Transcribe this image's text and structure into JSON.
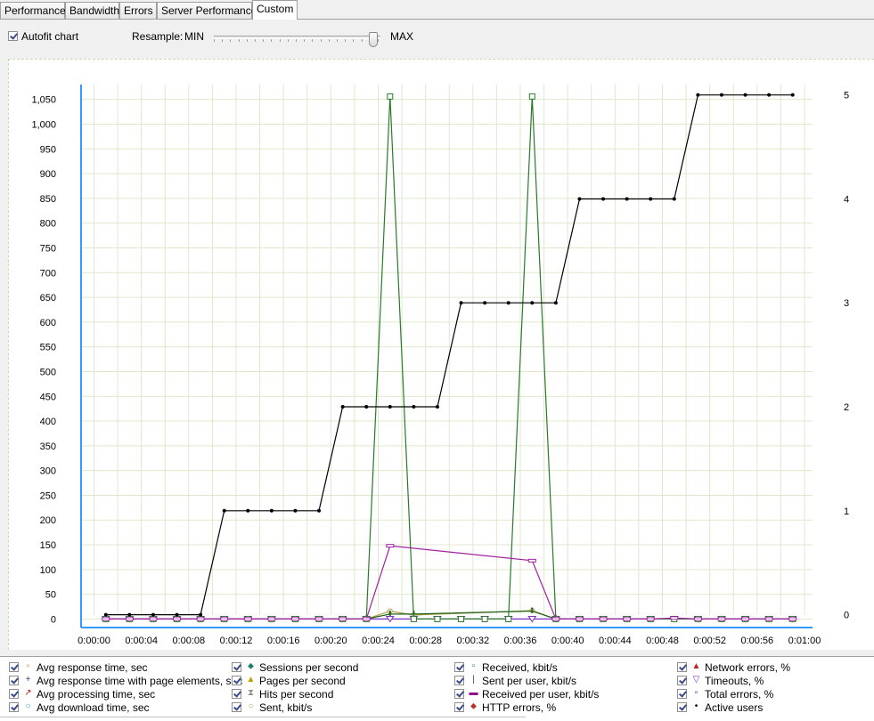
{
  "tabs": [
    "Performance",
    "Bandwidth",
    "Errors",
    "Server Performance",
    "Custom"
  ],
  "active_tab": "Custom",
  "controls": {
    "autofit_label": "Autofit chart",
    "autofit_checked": true,
    "resample_label": "Resample:",
    "resample_min": "MIN",
    "resample_max": "MAX",
    "resample_level": 1.0
  },
  "legend": {
    "columns": [
      [
        {
          "label": "Avg response time, sec",
          "icon": "square-marker",
          "color": "#e07030",
          "checked": true
        },
        {
          "label": "Avg response time with page elements, sec",
          "icon": "plus-marker",
          "color": "#404080",
          "checked": true
        },
        {
          "label": "Avg processing time, sec",
          "icon": "arrow-marker",
          "color": "#c02020",
          "checked": true
        },
        {
          "label": "Avg download time, sec",
          "icon": "circle-marker",
          "color": "#20a0c0",
          "checked": true
        }
      ],
      [
        {
          "label": "Sessions per second",
          "icon": "diamond-marker",
          "color": "#208070",
          "checked": true
        },
        {
          "label": "Pages per second",
          "icon": "triangle-marker",
          "color": "#c0a000",
          "checked": true
        },
        {
          "label": "Hits per second",
          "icon": "hourglass-marker",
          "color": "#909090",
          "checked": true
        },
        {
          "label": "Sent, kbit/s",
          "icon": "circle-marker",
          "color": "#a0a040",
          "checked": true
        }
      ],
      [
        {
          "label": "Received, kbit/s",
          "icon": "square-marker",
          "color": "#208020",
          "checked": true
        },
        {
          "label": "Sent per user, kbit/s",
          "icon": "bar-marker",
          "color": "#206020",
          "checked": true
        },
        {
          "label": "Received per user, kbit/s",
          "icon": "dash-marker",
          "color": "#900090",
          "checked": true
        },
        {
          "label": "HTTP errors, %",
          "icon": "diamond-marker",
          "color": "#c03030",
          "checked": true
        }
      ],
      [
        {
          "label": "Network errors, %",
          "icon": "triangle-marker",
          "color": "#c02020",
          "checked": true
        },
        {
          "label": "Timeouts, %",
          "icon": "down-triangle-marker",
          "color": "#8030c0",
          "checked": true
        },
        {
          "label": "Total errors, %",
          "icon": "square-marker",
          "color": "#202080",
          "checked": true
        },
        {
          "label": "Active users",
          "icon": "dot-marker",
          "color": "#000000",
          "checked": true
        }
      ]
    ]
  },
  "chart_data": {
    "type": "line",
    "x_ticks": [
      "0:00:00",
      "0:00:04",
      "0:00:08",
      "0:00:12",
      "0:00:16",
      "0:00:20",
      "0:00:24",
      "0:00:28",
      "0:00:32",
      "0:00:36",
      "0:00:40",
      "0:00:44",
      "0:00:48",
      "0:00:52",
      "0:00:56",
      "0:01:00"
    ],
    "x_range_sec": [
      0,
      60
    ],
    "y_left_ticks": [
      0,
      50,
      100,
      150,
      200,
      250,
      300,
      350,
      400,
      450,
      500,
      550,
      600,
      650,
      700,
      750,
      800,
      850,
      900,
      950,
      1000,
      1050
    ],
    "y_left_tick_labels": [
      "0",
      "50",
      "100",
      "150",
      "200",
      "250",
      "300",
      "350",
      "400",
      "450",
      "500",
      "550",
      "600",
      "650",
      "700",
      "750",
      "800",
      "850",
      "900",
      "950",
      "1,000",
      "1,050"
    ],
    "y_left_range": [
      -10,
      1080
    ],
    "y_right_ticks": [
      0,
      1,
      2,
      3,
      4,
      5
    ],
    "y_right_range": [
      -0.0893,
      5.1
    ],
    "grid": true,
    "sample_times_sec": [
      1,
      3,
      5,
      7,
      9,
      11,
      13,
      15,
      17,
      19,
      21,
      23,
      25,
      27,
      29,
      31,
      33,
      35,
      37,
      39,
      41,
      43,
      45,
      47,
      49,
      51,
      53,
      55,
      57,
      59
    ],
    "series": [
      {
        "name": "Active users",
        "axis": "right",
        "color": "#000000",
        "marker": "dot",
        "x": [
          1,
          3,
          5,
          7,
          9,
          11,
          13,
          15,
          17,
          19,
          21,
          23,
          25,
          27,
          29,
          31,
          33,
          35,
          37,
          39,
          41,
          43,
          45,
          47,
          49,
          51,
          53,
          55,
          57,
          59
        ],
        "y": [
          0,
          0,
          0,
          0,
          0,
          1,
          1,
          1,
          1,
          1,
          2,
          2,
          2,
          2,
          2,
          3,
          3,
          3,
          3,
          3,
          4,
          4,
          4,
          4,
          4,
          5,
          5,
          5,
          5,
          5
        ]
      },
      {
        "name": "Received, kbit/s",
        "axis": "left",
        "color": "#2a7a2a",
        "marker": "square",
        "x": [
          1,
          3,
          5,
          7,
          9,
          11,
          13,
          15,
          17,
          19,
          21,
          23,
          25,
          27,
          29,
          31,
          33,
          35,
          37,
          39,
          41,
          43,
          45,
          47,
          49,
          51,
          53,
          55,
          57,
          59
        ],
        "y": [
          0,
          0,
          0,
          0,
          0,
          0,
          0,
          0,
          0,
          0,
          0,
          0,
          1056,
          0,
          0,
          0,
          0,
          0,
          1056,
          0,
          0,
          0,
          0,
          0,
          0,
          0,
          0,
          0,
          0,
          0
        ]
      },
      {
        "name": "Received per user, kbit/s",
        "axis": "left",
        "color": "#a020a0",
        "marker": "dash",
        "x": [
          1,
          3,
          5,
          7,
          9,
          11,
          13,
          15,
          17,
          19,
          21,
          23,
          25,
          37,
          39,
          41,
          43,
          45,
          47,
          49,
          51,
          53,
          55,
          57,
          59
        ],
        "y": [
          0,
          0,
          0,
          0,
          0,
          0,
          0,
          0,
          0,
          0,
          0,
          0,
          148,
          118,
          0,
          0,
          0,
          0,
          0,
          2,
          0,
          0,
          0,
          0,
          0
        ]
      },
      {
        "name": "Sent, kbit/s",
        "axis": "left",
        "color": "#b0a040",
        "marker": "circle",
        "x": [
          23,
          25,
          27,
          37,
          39
        ],
        "y": [
          0,
          16,
          8,
          17,
          0
        ]
      },
      {
        "name": "Sent per user, kbit/s",
        "axis": "left",
        "color": "#206020",
        "marker": "bar",
        "x": [
          23,
          25,
          27,
          37,
          39
        ],
        "y": [
          0,
          10,
          10,
          16,
          0
        ]
      },
      {
        "name": "Timeouts, %",
        "axis": "left",
        "color": "#8030c0",
        "marker": "down-triangle",
        "x": [
          1,
          3,
          5,
          7,
          9,
          11,
          13,
          15,
          17,
          19,
          21,
          23,
          25,
          27,
          29,
          31,
          33,
          35,
          37,
          39,
          41,
          43,
          45,
          47,
          49,
          51,
          53,
          55,
          57,
          59
        ],
        "y": [
          0,
          0,
          0,
          0,
          0,
          0,
          0,
          0,
          0,
          0,
          0,
          0,
          0,
          0,
          0,
          0,
          0,
          0,
          0,
          0,
          0,
          0,
          0,
          0,
          0,
          0,
          0,
          0,
          0,
          0
        ]
      }
    ]
  }
}
